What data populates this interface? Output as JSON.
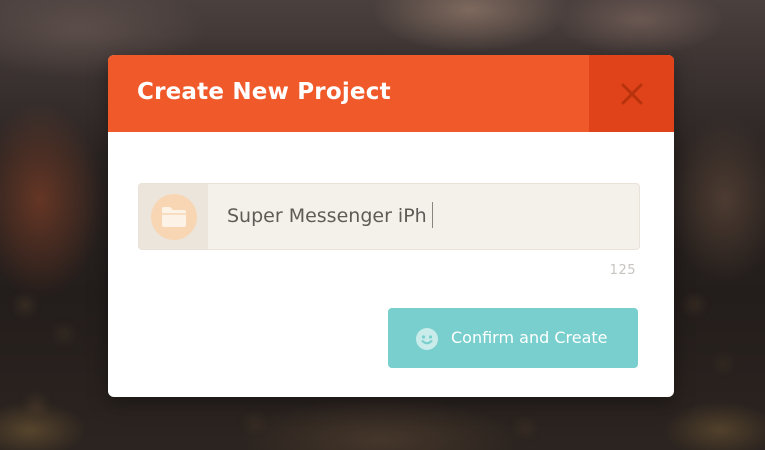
{
  "dialog": {
    "title": "Create New Project",
    "close_icon": "close-icon",
    "header_color": "#f05a2b",
    "close_bg_color": "#e0431a"
  },
  "project_name_field": {
    "icon": "folder-icon",
    "value": "Super Messenger iPh",
    "character_count": "125"
  },
  "confirm_button": {
    "label": "Confirm and Create",
    "icon": "smile-icon",
    "color": "#78cfcd"
  }
}
